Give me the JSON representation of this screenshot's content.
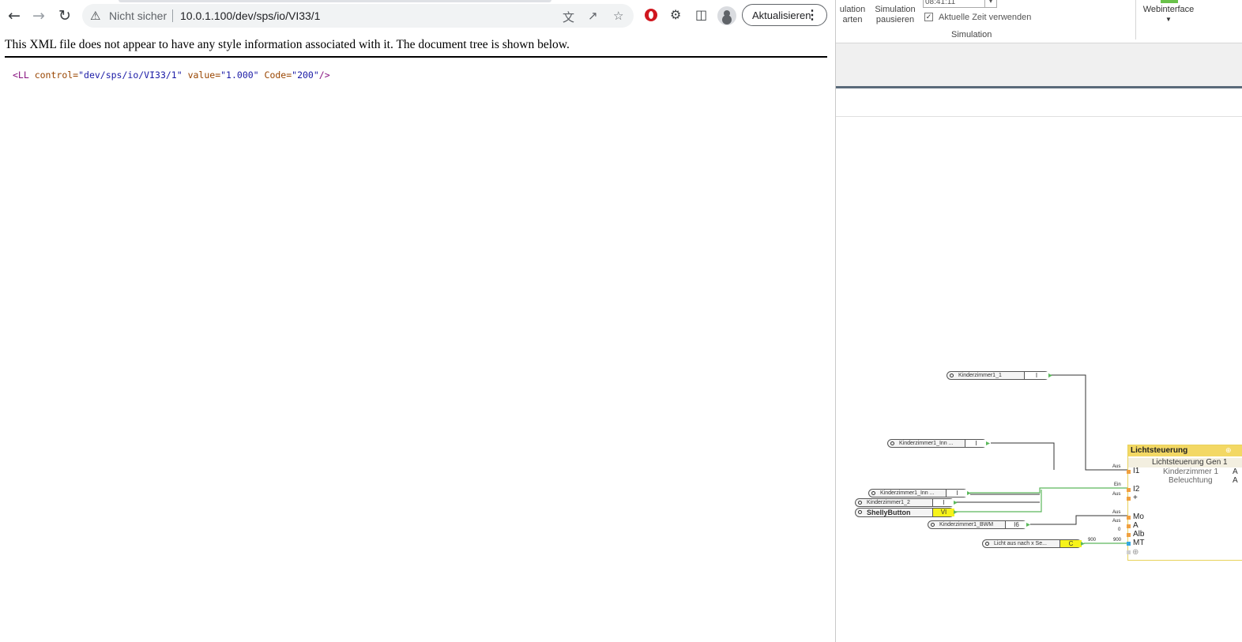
{
  "browser": {
    "omnibox": {
      "security_label": "Nicht sicher",
      "url": "10.0.1.100/dev/sps/io/VI33/1"
    },
    "update_button": "Aktualisieren",
    "icons": [
      "back-icon",
      "forward-icon",
      "reload-icon",
      "warning-icon",
      "translate-icon",
      "share-icon",
      "star-icon",
      "adblock-icon",
      "extensions-icon",
      "sidepanel-icon",
      "profile-icon",
      "menu-icon"
    ]
  },
  "xml": {
    "notice": "This XML file does not appear to have any style information associated with it. The document tree is shown below.",
    "tag_open": "<LL",
    "attr1": " control=",
    "val1": "\"dev/sps/io/VI33/1\"",
    "attr2": " value=",
    "val2": "\"1.000\"",
    "attr3": " Code=",
    "val3": "\"200\"",
    "tag_close": "/>"
  },
  "loxone": {
    "ribbon": {
      "sim_start_l1": "ulation",
      "sim_start_l2": "arten",
      "sim_pause_l1": "Simulation",
      "sim_pause_l2": "pausieren",
      "time_value": "08:41:11",
      "live_time_label": "Aktuelle Zeit verwenden",
      "group_label": "Simulation",
      "webinterface": "Webinterface"
    },
    "blocks": {
      "k1": {
        "name": "Kinderzimmer1_1",
        "type": "I"
      },
      "k_inn1": {
        "name": "Kinderzimmer1_Inn ...",
        "type": "I"
      },
      "k_inn2": {
        "name": "Kinderzimmer1_Inn ...",
        "type": "I"
      },
      "k2": {
        "name": "Kinderzimmer1_2",
        "type": "I"
      },
      "shelly": {
        "name": "ShellyButton",
        "type": "VI"
      },
      "bwm": {
        "name": "Kinderzimmer1_BWM",
        "type": "I6"
      },
      "licht": {
        "name": "Licht aus nach x Se...",
        "type": "C"
      }
    },
    "wire_labels": {
      "aus1": "Aus",
      "ein": "Ein",
      "aus2": "Aus",
      "aus3": "Aus",
      "aus4": "Aus",
      "zero": "0",
      "n900a": "900",
      "n900b": "900"
    },
    "lichtsteuerung": {
      "title": "Lichtsteuerung",
      "subtitle": "Lichtsteuerung Gen 1",
      "desc1": "Kinderzimmer 1",
      "desc2": "Beleuchtung",
      "right1": "A",
      "right2": "A",
      "inputs": {
        "i1": "I1",
        "i2": "I2",
        "plus": "+",
        "mo": "Mo",
        "a": "A",
        "alb": "Alb",
        "mt": "MT"
      }
    }
  }
}
